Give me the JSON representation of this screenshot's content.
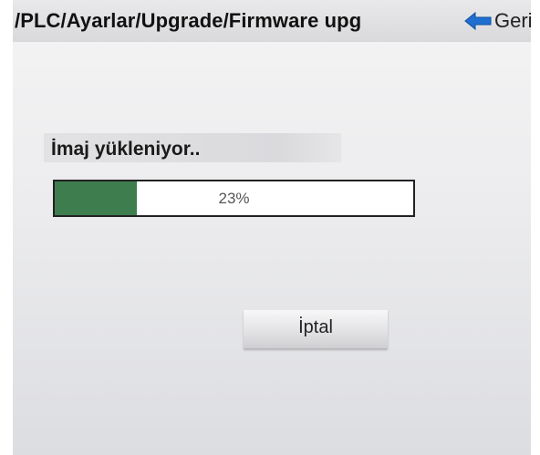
{
  "header": {
    "breadcrumb": "/PLC/Ayarlar/Upgrade/Firmware upg",
    "back_label": "Geri",
    "back_icon": "arrow-left-icon"
  },
  "upload": {
    "status_text": "İmaj yükleniyor..",
    "progress_percent": 23,
    "progress_label": "23%"
  },
  "actions": {
    "cancel_label": "İptal"
  },
  "colors": {
    "progress_fill": "#3e7d4d",
    "back_arrow": "#1f6fd1"
  }
}
